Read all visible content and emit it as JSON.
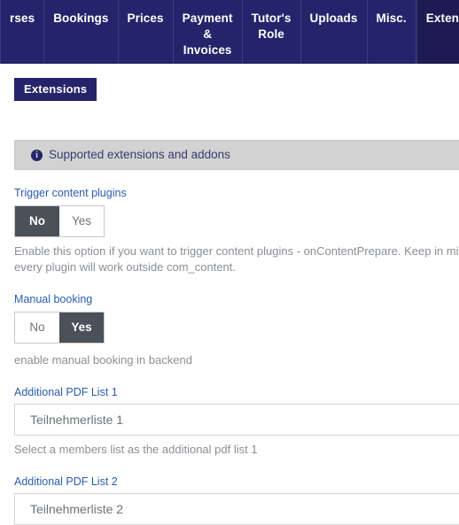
{
  "navbar": {
    "items": [
      {
        "label": "rses",
        "lines": [
          "rses"
        ],
        "active": false,
        "truncated": true
      },
      {
        "label": "Bookings",
        "lines": [
          "Bookings"
        ],
        "active": false
      },
      {
        "label": "Prices",
        "lines": [
          "Prices"
        ],
        "active": false
      },
      {
        "label": "Payment & Invoices",
        "lines": [
          "Payment",
          "&",
          "Invoices"
        ],
        "active": false
      },
      {
        "label": "Tutor's Role",
        "lines": [
          "Tutor's",
          "Role"
        ],
        "active": false
      },
      {
        "label": "Uploads",
        "lines": [
          "Uploads"
        ],
        "active": false
      },
      {
        "label": "Misc.",
        "lines": [
          "Misc."
        ],
        "active": false
      },
      {
        "label": "Extensions",
        "lines": [
          "Extensions"
        ],
        "active": true
      }
    ]
  },
  "page": {
    "badge": "Extensions",
    "alert": {
      "icon": "info-icon",
      "icon_glyph": "i",
      "text": "Supported extensions and addons"
    },
    "fields": [
      {
        "label": "Trigger content plugins",
        "type": "toggle",
        "options": [
          "No",
          "Yes"
        ],
        "selected": "No",
        "help": "Enable this option if you want to trigger content plugins - onContentPrepare. Keep in mind not every plugin will work outside com_content."
      },
      {
        "label": "Manual booking",
        "type": "toggle",
        "options": [
          "No",
          "Yes"
        ],
        "selected": "Yes",
        "help": "enable manual booking in backend"
      },
      {
        "label": "Additional PDF List 1",
        "type": "select",
        "value": "Teilnehmerliste 1",
        "help": "Select a members list as the additional pdf list 1"
      },
      {
        "label": "Additional PDF List 2",
        "type": "select",
        "value": "Teilnehmerliste 2",
        "help": ""
      }
    ]
  },
  "colors": {
    "nav_background": "#25246b",
    "nav_active": "#1c1b52",
    "badge_background": "#25246b",
    "label_link": "#2a5db0",
    "toggle_active": "#4a5158",
    "alert_background": "#d2d2d2",
    "help_text": "#8b8f94"
  }
}
